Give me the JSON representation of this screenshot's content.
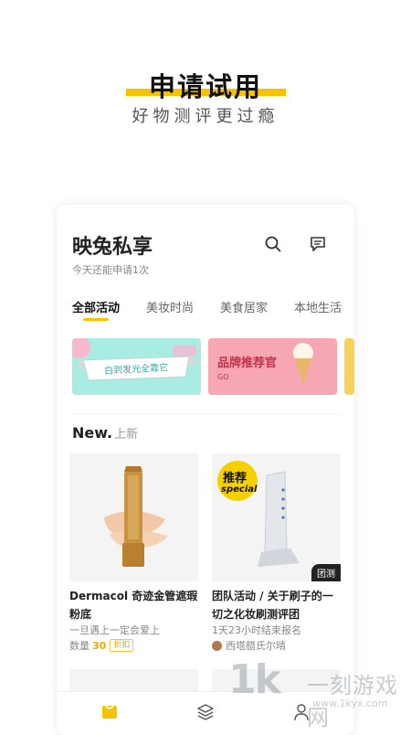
{
  "hero": {
    "title": "申请试用",
    "subtitle": "好物测评更过瘾",
    "accent": "#f5c400"
  },
  "card": {
    "title": "映兔私享",
    "subtitle": "今天还能申请1次",
    "search_icon": "search-icon",
    "message_icon": "message-icon"
  },
  "tabs": [
    {
      "label": "全部活动",
      "active": true
    },
    {
      "label": "美妆时尚",
      "active": false
    },
    {
      "label": "美食居家",
      "active": false
    },
    {
      "label": "本地生活",
      "active": false
    }
  ],
  "banners": [
    {
      "text": "白到发光全靠它"
    },
    {
      "text": "品牌推荐官",
      "sub": "GO"
    }
  ],
  "section": {
    "title": "New.",
    "subtitle": "上新"
  },
  "products": [
    {
      "name": "Dermacol 奇迹金管遮瑕粉底",
      "desc": "一旦遇上一定会爱上",
      "qty_label": "数量",
      "qty": "30",
      "tag": "折扣"
    },
    {
      "name": "团队活动 / 关于刷子的一切之化妆刷测评团",
      "desc": "1天23小时结束报名",
      "author": "西塔腊氏尔晴",
      "badge": "团测",
      "sticker_top": "推荐",
      "sticker_bottom": "special"
    }
  ],
  "bottom_nav": [
    "home-icon",
    "layers-icon",
    "profile-icon"
  ],
  "watermark": {
    "big": "1k",
    "cn": "一刻游戏网",
    "url": "www.1kyx.com"
  }
}
